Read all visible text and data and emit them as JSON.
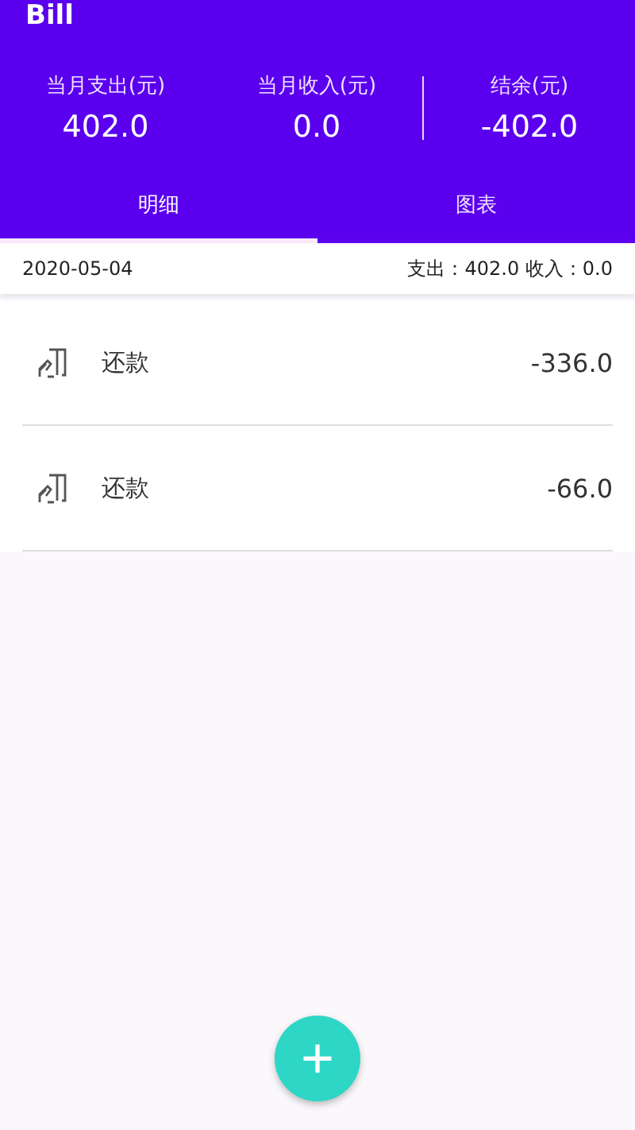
{
  "app_bar": {
    "title": "Bill"
  },
  "summary": [
    {
      "label": "当月支出(元)",
      "value": "402.0"
    },
    {
      "label": "当月收入(元)",
      "value": "0.0"
    },
    {
      "label": "结余(元)",
      "value": "-402.0"
    }
  ],
  "tabs": [
    {
      "label": "明细",
      "selected": true
    },
    {
      "label": "图表",
      "selected": false
    }
  ],
  "day": {
    "date": "2020-05-04",
    "totals": "支出：402.0 收入：0.0"
  },
  "entries": [
    {
      "name": "还款",
      "amount": "-336.0"
    },
    {
      "name": "还款",
      "amount": "-66.0"
    }
  ],
  "fab": {
    "label": "+"
  }
}
